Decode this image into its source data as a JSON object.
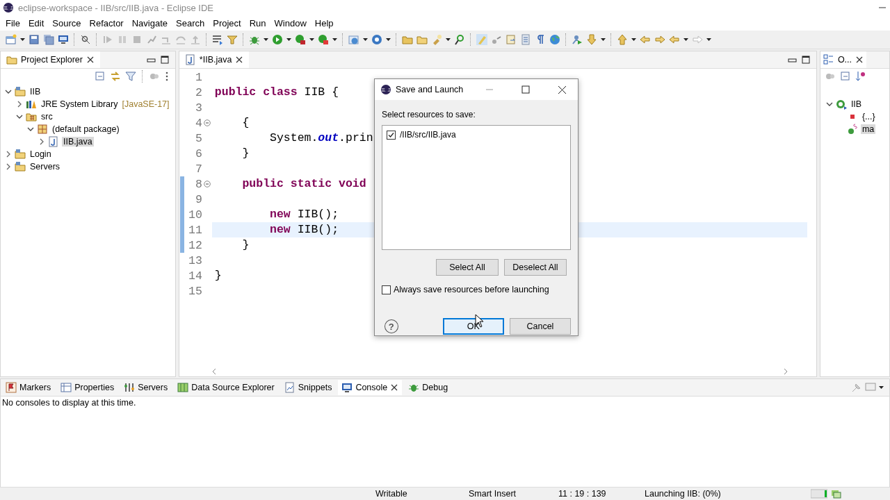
{
  "window": {
    "title": "eclipse-workspace - IIB/src/IIB.java - Eclipse IDE"
  },
  "menu": [
    "File",
    "Edit",
    "Source",
    "Refactor",
    "Navigate",
    "Search",
    "Project",
    "Run",
    "Window",
    "Help"
  ],
  "project_explorer": {
    "title": "Project Explorer",
    "tree": [
      {
        "label": "IIB",
        "kind": "project",
        "expanded": true,
        "selected": false,
        "children": [
          {
            "label": "JRE System Library",
            "decoration": "[JavaSE-17]",
            "kind": "library",
            "expanded": false,
            "selected": false
          },
          {
            "label": "src",
            "kind": "source-folder",
            "expanded": true,
            "selected": false,
            "children": [
              {
                "label": "(default package)",
                "kind": "package",
                "expanded": true,
                "selected": false,
                "children": [
                  {
                    "label": "IIB.java",
                    "kind": "java-file",
                    "expanded": false,
                    "selected": true
                  }
                ]
              }
            ]
          }
        ]
      },
      {
        "label": "Login",
        "kind": "project",
        "expanded": false,
        "selected": false
      },
      {
        "label": "Servers",
        "kind": "project",
        "expanded": false,
        "selected": false
      }
    ]
  },
  "editor": {
    "tab": {
      "label": "*IIB.java"
    },
    "lines": [
      {
        "number": "1",
        "current": false,
        "changed": false,
        "fold": false
      },
      {
        "number": "2",
        "segments": [
          {
            "text": "public class",
            "kind": "keyword"
          },
          {
            "text": " IIB {",
            "kind": "plain"
          }
        ],
        "current": false,
        "changed": false,
        "fold": false
      },
      {
        "number": "3",
        "current": false,
        "changed": false,
        "fold": false
      },
      {
        "number": "4",
        "segments": [
          {
            "text": "    {",
            "kind": "plain"
          }
        ],
        "current": false,
        "changed": false,
        "fold": true
      },
      {
        "number": "5",
        "segments": [
          {
            "text": "        System.",
            "kind": "plain"
          },
          {
            "text": "out",
            "kind": "field"
          },
          {
            "text": ".prin",
            "kind": "plain"
          }
        ],
        "current": false,
        "changed": false,
        "fold": false
      },
      {
        "number": "6",
        "segments": [
          {
            "text": "    }",
            "kind": "plain"
          }
        ],
        "current": false,
        "changed": false,
        "fold": false
      },
      {
        "number": "7",
        "current": false,
        "changed": false,
        "fold": false
      },
      {
        "number": "8",
        "segments": [
          {
            "text": "    public static void",
            "kind": "keyword"
          }
        ],
        "current": false,
        "changed": true,
        "fold": true
      },
      {
        "number": "9",
        "current": false,
        "changed": true,
        "fold": false
      },
      {
        "number": "10",
        "segments": [
          {
            "text": "        new",
            "kind": "keyword"
          },
          {
            "text": " IIB();",
            "kind": "plain"
          }
        ],
        "current": false,
        "changed": true,
        "fold": false
      },
      {
        "number": "11",
        "segments": [
          {
            "text": "        new",
            "kind": "keyword"
          },
          {
            "text": " IIB();",
            "kind": "plain"
          }
        ],
        "current": true,
        "changed": true,
        "fold": false
      },
      {
        "number": "12",
        "segments": [
          {
            "text": "    }",
            "kind": "plain"
          }
        ],
        "current": false,
        "changed": true,
        "fold": false
      },
      {
        "number": "13",
        "current": false,
        "changed": false,
        "fold": false
      },
      {
        "number": "14",
        "segments": [
          {
            "text": "}",
            "kind": "plain"
          }
        ],
        "current": false,
        "changed": false,
        "fold": false
      },
      {
        "number": "15",
        "current": false,
        "changed": false,
        "fold": false
      }
    ]
  },
  "outline": {
    "title": "O...",
    "tree": [
      {
        "label": "IIB",
        "kind": "class",
        "expanded": true,
        "selected": false,
        "children": [
          {
            "label": "{...}",
            "kind": "block",
            "selected": false
          },
          {
            "label": "ma",
            "kind": "method",
            "selected": true
          }
        ]
      }
    ]
  },
  "dialog": {
    "title": "Save and Launch",
    "prompt": "Select resources to save:",
    "resources": [
      {
        "label": "/IIB/src/IIB.java",
        "checked": true
      }
    ],
    "list_buttons": [
      "Select All",
      "Deselect All"
    ],
    "always_save": {
      "label": "Always save resources before launching",
      "checked": false
    },
    "help": "?",
    "ok": "OK",
    "cancel": "Cancel"
  },
  "bottom_panel": {
    "tabs": [
      {
        "label": "Markers",
        "kind": "markers",
        "selected": false
      },
      {
        "label": "Properties",
        "kind": "properties",
        "selected": false
      },
      {
        "label": "Servers",
        "kind": "servers",
        "selected": false
      },
      {
        "label": "Data Source Explorer",
        "kind": "datasource",
        "selected": false
      },
      {
        "label": "Snippets",
        "kind": "snippets",
        "selected": false
      },
      {
        "label": "Console",
        "kind": "console",
        "selected": true
      },
      {
        "label": "Debug",
        "kind": "debug",
        "selected": false
      }
    ],
    "message": "No consoles to display at this time."
  },
  "status_bar": {
    "mode": "Writable",
    "insert": "Smart Insert",
    "position": "11 : 19 : 139",
    "job": "Launching IIB: (0%)"
  }
}
